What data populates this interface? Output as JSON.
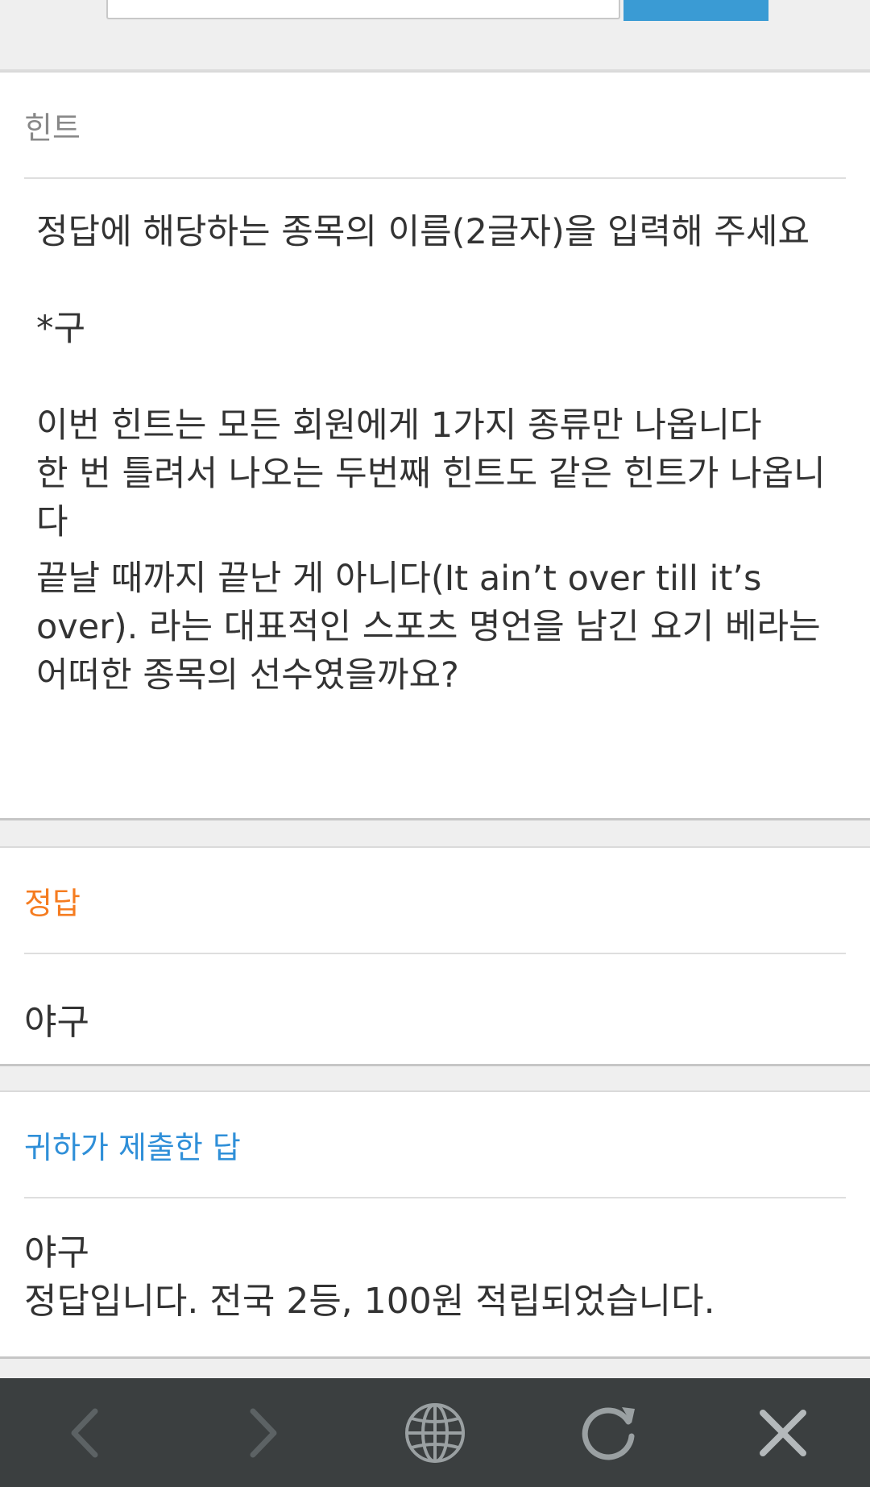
{
  "hint_section": {
    "title": "힌트",
    "instruction": "정답에 해당하는 종목의 이름(2글자)을 입력해 주세요",
    "prefix": "*구",
    "notice": "이번 힌트는 모든 회원에게 1가지 종류만 나옵니다\n한 번 틀려서 나오는 두번째 힌트도 같은 힌트가 나옵니다",
    "question": "끝날 때까지 끝난 게 아니다(It ain’t over till it’s over). 라는 대표적인 스포츠 명언을 남긴 요기 베라는 어떠한 종목의 선수였을까요?"
  },
  "answer_section": {
    "title": "정답",
    "value": "야구"
  },
  "submitted_section": {
    "title": "귀하가 제출한 답",
    "value": "야구",
    "result": "정답입니다. 전국 2등, 100원 적립되었습니다."
  },
  "bottom_nav": {
    "icons": [
      "back-icon",
      "forward-icon",
      "globe-icon",
      "refresh-icon",
      "close-icon"
    ]
  },
  "colors": {
    "answer_title": "#f57c20",
    "submitted_title": "#2f8fd8",
    "submit_button": "#3a9bd4",
    "nav_background": "#3b3f40"
  }
}
